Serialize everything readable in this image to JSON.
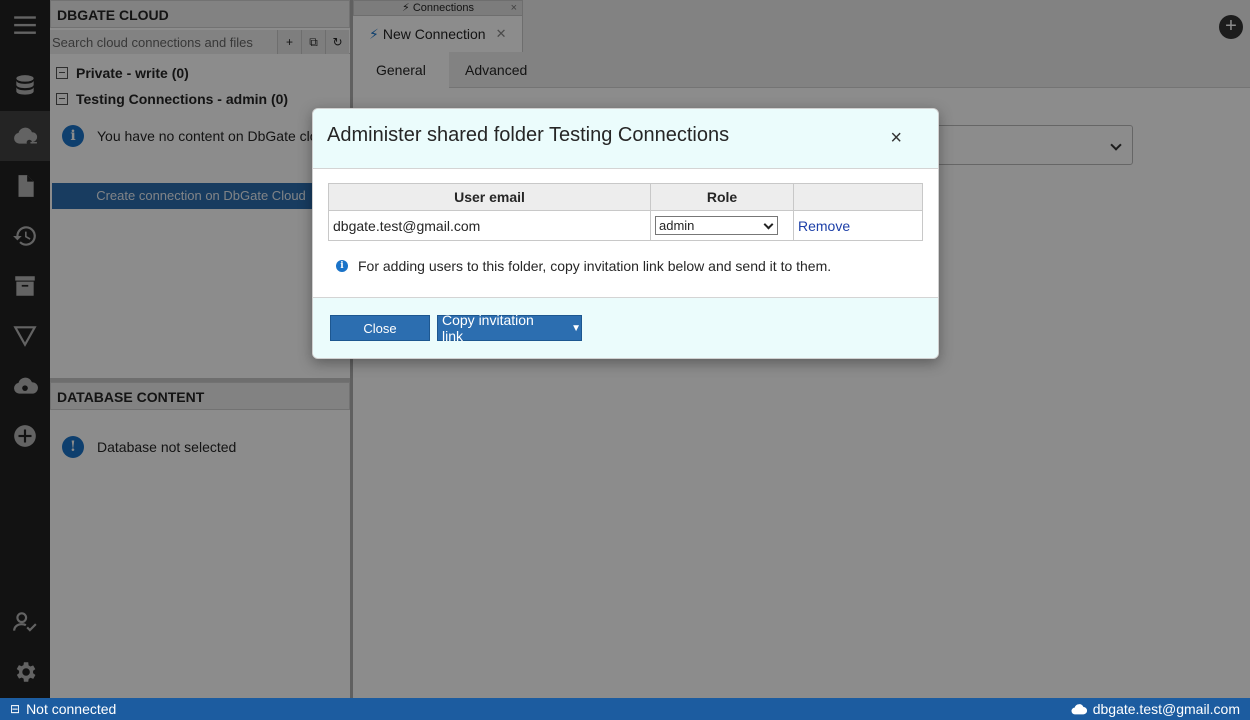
{
  "left_panel": {
    "header": "DBGATE CLOUD",
    "search_placeholder": "Search cloud connections and files",
    "search_buttons": [
      "+",
      "⧉",
      "↻"
    ],
    "folders": [
      {
        "label": "Private - write (0)"
      },
      {
        "label": "Testing Connections - admin (0)"
      }
    ],
    "empty_message": "You have no content on DbGate cloud",
    "create_button": "Create connection on DbGate Cloud",
    "db_header": "DATABASE CONTENT",
    "db_message": "Database not selected"
  },
  "tabs": {
    "group_label": "Connections",
    "active_tab": "New Connection",
    "subtabs": [
      "General",
      "Advanced"
    ],
    "add_button": "+"
  },
  "icons": {
    "menu": "menu-icon",
    "database": "database-icon",
    "cloud": "cloud-key-icon",
    "file": "file-icon",
    "history": "history-icon",
    "archive": "archive-icon",
    "filter": "filter-icon",
    "cloud_search": "cloud-search-icon",
    "plus": "plus-circle-icon",
    "account": "account-check-icon",
    "settings": "gear-icon"
  },
  "modal": {
    "title": "Administer shared folder Testing Connections",
    "close_symbol": "×",
    "columns": [
      "User email",
      "Role",
      ""
    ],
    "rows": [
      {
        "email": "dbgate.test@gmail.com",
        "role": "admin",
        "action": "Remove"
      }
    ],
    "note": "For adding users to this folder, copy invitation link below and send it to them.",
    "close_button": "Close",
    "copy_button": "Copy invitation link"
  },
  "status": {
    "connection": "Not connected",
    "user": "dbgate.test@gmail.com"
  },
  "colors": {
    "accent": "#2c6eb0",
    "statusbar": "#1c5ca0",
    "modal_header": "#ebfcfc"
  }
}
